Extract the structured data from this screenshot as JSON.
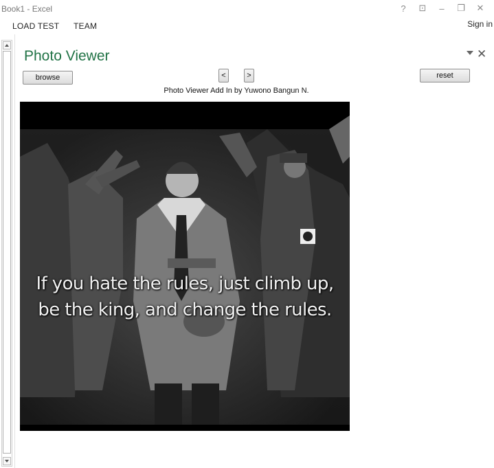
{
  "window": {
    "title": "Book1 - Excel",
    "controls": {
      "help": "?",
      "ribbon_display": "⊡",
      "minimize": "–",
      "restore": "❐",
      "close": "✕"
    }
  },
  "ribbon": {
    "tabs": [
      "LOAD TEST",
      "TEAM"
    ],
    "sign_in": "Sign in"
  },
  "pane": {
    "title": "Photo Viewer",
    "close": "✕",
    "browse_label": "browse",
    "prev_label": "<",
    "next_label": ">",
    "reset_label": "reset",
    "caption": "Photo Viewer Add In by Yuwono Bangun N."
  },
  "photo": {
    "quote_line1": "If you hate the rules, just climb up,",
    "quote_line2": "be the king, and change the rules."
  }
}
